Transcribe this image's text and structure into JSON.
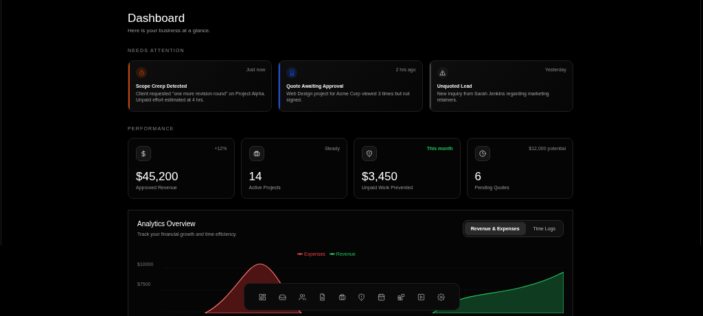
{
  "header": {
    "title": "Dashboard",
    "subtitle": "Here is your business at a glance."
  },
  "attention": {
    "heading": "NEEDS ATTENTION",
    "items": [
      {
        "kind": "timer",
        "color": "#c2410c",
        "time": "Just now",
        "title": "Scope Creep Detected",
        "text": "Client requested \"one more revision round\" on Project Alpha. Unpaid effort estimated at 4 hrs."
      },
      {
        "kind": "document",
        "color": "#1d4ed8",
        "time": "2 hrs ago",
        "title": "Quote Awaiting Approval",
        "text": "Web Design project for Acme Corp viewed 3 times but not signed."
      },
      {
        "kind": "warning",
        "color": "#3f3f46",
        "time": "Yesterday",
        "title": "Unquoted Lead",
        "text": "New inquiry from Sarah Jenkins regarding marketing retainers."
      }
    ]
  },
  "performance": {
    "heading": "PERFORMANCE",
    "stats": [
      {
        "kind": "dollar",
        "note": "+12%",
        "positive": false,
        "value": "$45,200",
        "label": "Approved Revenue"
      },
      {
        "kind": "briefcase",
        "note": "Steady",
        "positive": false,
        "value": "14",
        "label": "Active Projects"
      },
      {
        "kind": "shield",
        "note": "This month",
        "positive": true,
        "value": "$3,450",
        "label": "Unpaid Work Prevented"
      },
      {
        "kind": "clock",
        "note": "$12,000 potential",
        "positive": false,
        "value": "6",
        "label": "Pending Quotes"
      }
    ]
  },
  "analytics": {
    "title": "Analytics Overview",
    "subtitle": "Track your financial growth and time efficiency.",
    "tabs": [
      {
        "label": "Revenue & Expenses",
        "selected": true
      },
      {
        "label": "Time Logs",
        "selected": false
      }
    ],
    "legend": [
      {
        "label": "Expenses",
        "color": "#ef4444"
      },
      {
        "label": "Revenue",
        "color": "#22c55e"
      }
    ],
    "y_labels": [
      "$10000",
      "$7500"
    ]
  }
}
